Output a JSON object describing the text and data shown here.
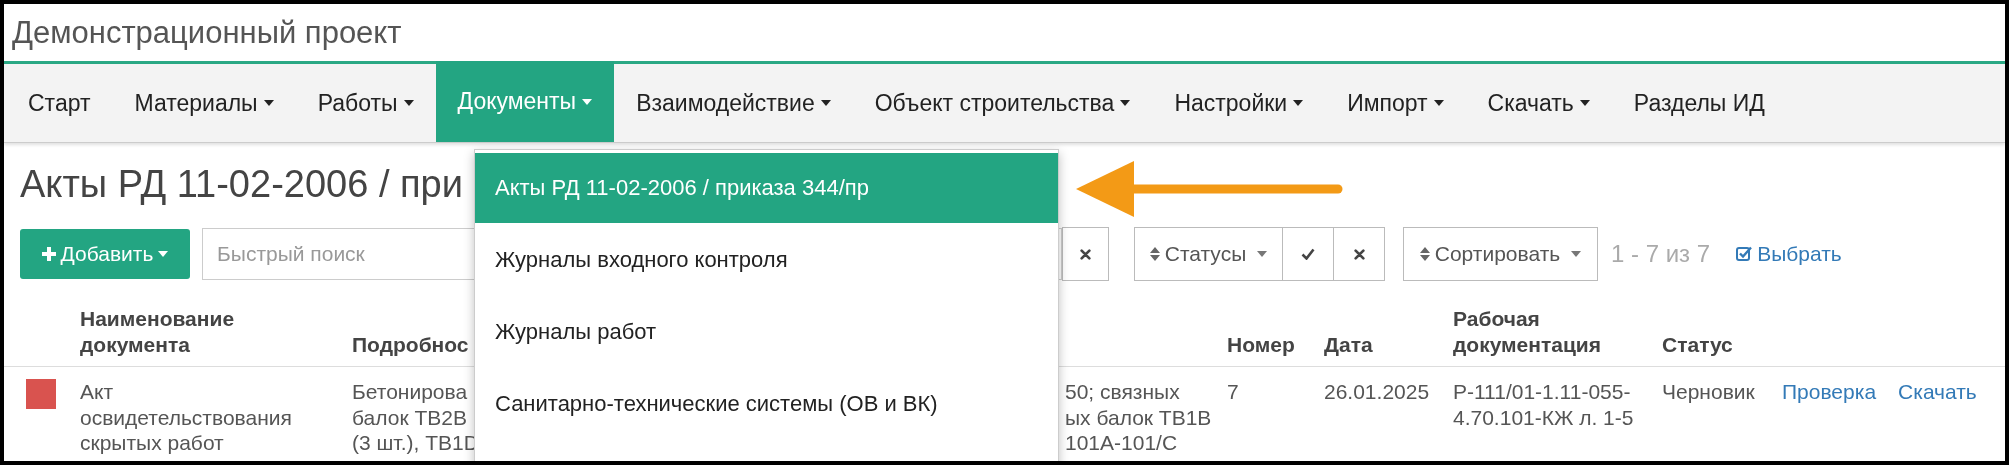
{
  "title": "Демонстрационный проект",
  "nav": [
    {
      "label": "Старт",
      "selected": false,
      "has_menu": false
    },
    {
      "label": "Материалы",
      "selected": false,
      "has_menu": true
    },
    {
      "label": "Работы",
      "selected": false,
      "has_menu": true
    },
    {
      "label": "Документы",
      "selected": true,
      "has_menu": true
    },
    {
      "label": "Взаимодействие",
      "selected": false,
      "has_menu": true
    },
    {
      "label": "Объект строительства",
      "selected": false,
      "has_menu": true
    },
    {
      "label": "Настройки",
      "selected": false,
      "has_menu": true
    },
    {
      "label": "Импорт",
      "selected": false,
      "has_menu": true
    },
    {
      "label": "Скачать",
      "selected": false,
      "has_menu": true
    },
    {
      "label": "Разделы ИД",
      "selected": false,
      "has_menu": false
    }
  ],
  "dropdown": {
    "items": [
      {
        "label": "Акты РД 11-02-2006 / приказа 344/пр",
        "selected": true
      },
      {
        "label": "Журналы входного контроля",
        "selected": false
      },
      {
        "label": "Журналы работ",
        "selected": false
      },
      {
        "label": "Санитарно-технические системы (ОВ и ВК)",
        "selected": false
      }
    ]
  },
  "heading": "Акты РД 11-02-2006 / при",
  "toolbar": {
    "add_button": "Добавить",
    "search": {
      "placeholder": "Быстрый поиск"
    },
    "statuses_button": "Статусы",
    "sort_button": "Сортировать",
    "range": "1 - 7 из 7",
    "select_link": "Выбрать"
  },
  "table": {
    "columns": [
      "Наименование документа",
      "Подробнос",
      "Номер",
      "Дата",
      "Рабочая документация",
      "Статус"
    ],
    "rows": [
      {
        "color": "#d9534f",
        "name": "Акт освидетельствования скрытых работ",
        "details_left": [
          "Бетонирова",
          "балок ТВ2В",
          "(3 шт.), ТВ1D"
        ],
        "details_right": [
          "50; связных",
          "ых балок ТВ1В",
          "101А-101/С"
        ],
        "number": "7",
        "date": "26.01.2025",
        "rd": "Р-111/01-1.11-055-4.70.101-КЖ л. 1-5",
        "status": "Черновик",
        "actions": [
          "Проверка",
          "Скачать"
        ]
      }
    ]
  }
}
